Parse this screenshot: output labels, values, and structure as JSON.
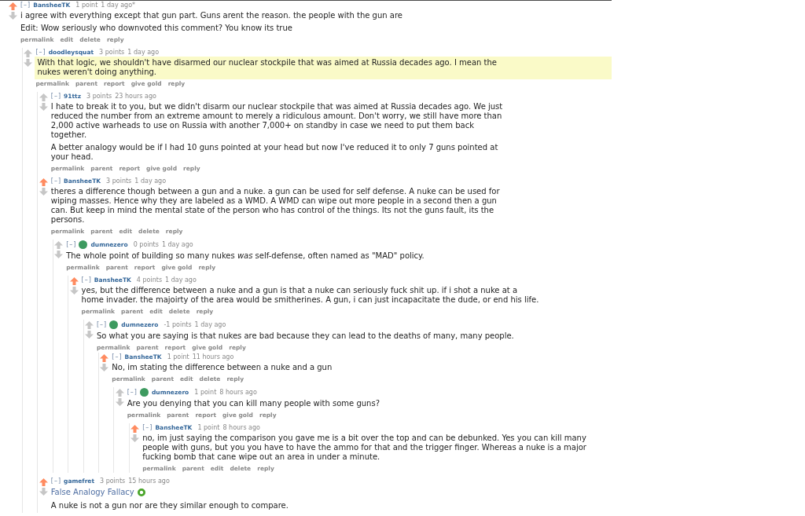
{
  "comments": [
    {
      "collapse": "[–]",
      "author": "BansheeTK",
      "score": "1 point",
      "time": "1 day ago*",
      "upvoted": true,
      "flair_dot": false,
      "highlighted": false,
      "paragraphs": [
        {
          "kind": "text",
          "text": "i agree with everything except that gun part. Guns arent the reason. the people with the gun are"
        },
        {
          "kind": "text",
          "text": "Edit: Wow seriously who downvoted this comment? You know its true"
        }
      ],
      "actions": [
        "permalink",
        "edit",
        "delete",
        "reply"
      ],
      "children": [
        {
          "collapse": "[–]",
          "author": "doodleysquat",
          "score": "3 points",
          "time": "1 day ago",
          "upvoted": false,
          "flair_dot": false,
          "highlighted": true,
          "paragraphs": [
            {
              "kind": "text",
              "text": "With that logic, we shouldn't have disarmed our nuclear stockpile that was aimed at Russia decades ago. I mean the nukes weren't doing anything."
            }
          ],
          "actions": [
            "permalink",
            "parent",
            "report",
            "give gold",
            "reply"
          ],
          "children": [
            {
              "collapse": "[–]",
              "author": "91ttz",
              "score": "3 points",
              "time": "23 hours ago",
              "upvoted": false,
              "flair_dot": false,
              "highlighted": false,
              "paragraphs": [
                {
                  "kind": "text",
                  "text": "I hate to break it to you, but we didn't disarm our nuclear stockpile that was aimed at Russia decades ago. We just reduced the number from an extreme amount to merely a ridiculous amount. Don't worry, we still have more than 2,000 active warheads to use on Russia with another 7,000+ on standby in case we need to put them back together."
                },
                {
                  "kind": "text",
                  "text": "A better analogy would be if I had 10 guns pointed at your head but now I've reduced it to only 7 guns pointed at your head."
                }
              ],
              "actions": [
                "permalink",
                "parent",
                "report",
                "give gold",
                "reply"
              ]
            },
            {
              "collapse": "[–]",
              "author": "BansheeTK",
              "score": "3 points",
              "time": "1 day ago",
              "upvoted": true,
              "flair_dot": false,
              "highlighted": false,
              "paragraphs": [
                {
                  "kind": "text",
                  "text": "theres a difference though between a gun and a nuke. a gun can be used for self defense. A nuke can be used for wiping masses. Hence why they are labeled as a WMD. A WMD can wipe out more people in a second then a gun can. But keep in mind the mental state of the person who has control of the things. Its not the guns fault, its the persons."
                }
              ],
              "actions": [
                "permalink",
                "parent",
                "edit",
                "delete",
                "reply"
              ],
              "children": [
                {
                  "collapse": "[–]",
                  "author": "dumnezero",
                  "score": "0 points",
                  "time": "1 day ago",
                  "upvoted": false,
                  "flair_dot": true,
                  "highlighted": false,
                  "paragraphs": [
                    {
                      "kind": "text",
                      "text": "The whole point of building so many nukes *was* self-defense, often named as \"MAD\" policy."
                    }
                  ],
                  "actions": [
                    "permalink",
                    "parent",
                    "report",
                    "give gold",
                    "reply"
                  ],
                  "children": [
                    {
                      "collapse": "[–]",
                      "author": "BansheeTK",
                      "score": "4 points",
                      "time": "1 day ago",
                      "upvoted": true,
                      "flair_dot": false,
                      "highlighted": false,
                      "paragraphs": [
                        {
                          "kind": "text",
                          "text": "yes, but the difference between a nuke and a gun is that a nuke can seriously fuck shit up. if i shot a nuke at a home invader. the majoirty of the area would be smitherines. A gun, i can just incapacitate the dude, or end his life."
                        }
                      ],
                      "actions": [
                        "permalink",
                        "parent",
                        "edit",
                        "delete",
                        "reply"
                      ],
                      "children": [
                        {
                          "collapse": "[–]",
                          "author": "dumnezero",
                          "score": "-1 points",
                          "time": "1 day ago",
                          "upvoted": false,
                          "flair_dot": true,
                          "highlighted": false,
                          "paragraphs": [
                            {
                              "kind": "text",
                              "text": "So what you are saying is that nukes are bad because they can lead to the deaths of many, many people."
                            }
                          ],
                          "actions": [
                            "permalink",
                            "parent",
                            "report",
                            "give gold",
                            "reply"
                          ],
                          "children": [
                            {
                              "collapse": "[–]",
                              "author": "BansheeTK",
                              "score": "1 point",
                              "time": "11 hours ago",
                              "upvoted": true,
                              "flair_dot": false,
                              "highlighted": false,
                              "paragraphs": [
                                {
                                  "kind": "text",
                                  "text": "No, im stating the difference between a nuke and a gun"
                                }
                              ],
                              "actions": [
                                "permalink",
                                "parent",
                                "edit",
                                "delete",
                                "reply"
                              ],
                              "children": [
                                {
                                  "collapse": "[–]",
                                  "author": "dumnezero",
                                  "score": "1 point",
                                  "time": "8 hours ago",
                                  "upvoted": false,
                                  "flair_dot": true,
                                  "highlighted": false,
                                  "paragraphs": [
                                    {
                                      "kind": "text",
                                      "text": "Are you denying that you can kill many people with some guns?"
                                    }
                                  ],
                                  "actions": [
                                    "permalink",
                                    "parent",
                                    "report",
                                    "give gold",
                                    "reply"
                                  ],
                                  "children": [
                                    {
                                      "collapse": "[–]",
                                      "author": "BansheeTK",
                                      "score": "1 point",
                                      "time": "8 hours ago",
                                      "upvoted": true,
                                      "flair_dot": false,
                                      "highlighted": false,
                                      "paragraphs": [
                                        {
                                          "kind": "text",
                                          "text": "no, im just saying the comparison you gave me is a bit over the top and can be debunked. Yes you can kill many people with guns, but you you have to have the ammo for that and the trigger finger. Whereas a nuke is a major fucking bomb that cane wipe out an area in under a minute."
                                        }
                                      ],
                                      "actions": [
                                        "permalink",
                                        "parent",
                                        "edit",
                                        "delete",
                                        "reply"
                                      ]
                                    }
                                  ]
                                }
                              ]
                            }
                          ]
                        }
                      ]
                    }
                  ]
                }
              ]
            },
            {
              "collapse": "[–]",
              "author": "gamefret",
              "score": "3 points",
              "time": "15 hours ago",
              "upvoted": true,
              "flair_dot": false,
              "highlighted": false,
              "paragraphs": [
                {
                  "kind": "link",
                  "text": "False Analogy Fallacy"
                },
                {
                  "kind": "text",
                  "text": "A nuke is not a gun nor are they similar enough to compare."
                }
              ]
            }
          ]
        }
      ]
    }
  ]
}
